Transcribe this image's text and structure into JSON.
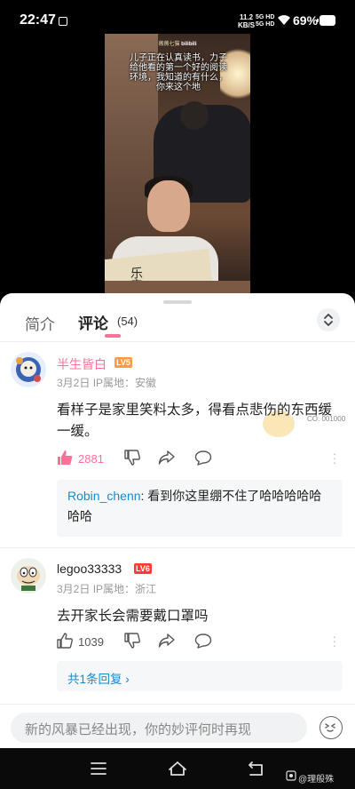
{
  "status_bar": {
    "time": "22:47",
    "net_speed": "11.2",
    "net_unit": "KB/S",
    "signal_top": "5G HD",
    "signal_bottom": "5G HD",
    "battery": "69%"
  },
  "video": {
    "channel": "薇薇七猫",
    "channel_brand": "bilibili",
    "caption": "儿子正在认真读书，力子给他看的第一个好的阅读环境，我知道的有什么，你来这个地",
    "book_title": "乐章"
  },
  "tabs": {
    "intro": "简介",
    "comments": "评论",
    "count": "(54)"
  },
  "comments": [
    {
      "username": "半生皆白",
      "level": "LV5",
      "date": "3月2日",
      "location": "IP属地：安徽",
      "text": "看样子是家里笑料太多，得看点悲伤的东西缓一缓。",
      "likes": "2881",
      "fan_badge_no": "CO. 001000",
      "reply": {
        "name": "Robin_chenn",
        "text": ": 看到你这里绷不住了哈哈哈哈哈哈哈"
      }
    },
    {
      "username": "legoo33333",
      "level": "LV6",
      "date": "3月2日",
      "location": "IP属地：浙江",
      "text": "去开家长会需要戴口罩吗",
      "likes": "1039",
      "replies_link": "共1条回复 ›"
    }
  ],
  "input": {
    "placeholder": "新的风暴已经出现，你的妙评何时再现"
  },
  "watermark": "@理般殊",
  "colors": {
    "accent_pink": "#fb7299",
    "link_blue": "#178bcf",
    "lv5": "#ff9a45",
    "lv6": "#ff3c33"
  }
}
